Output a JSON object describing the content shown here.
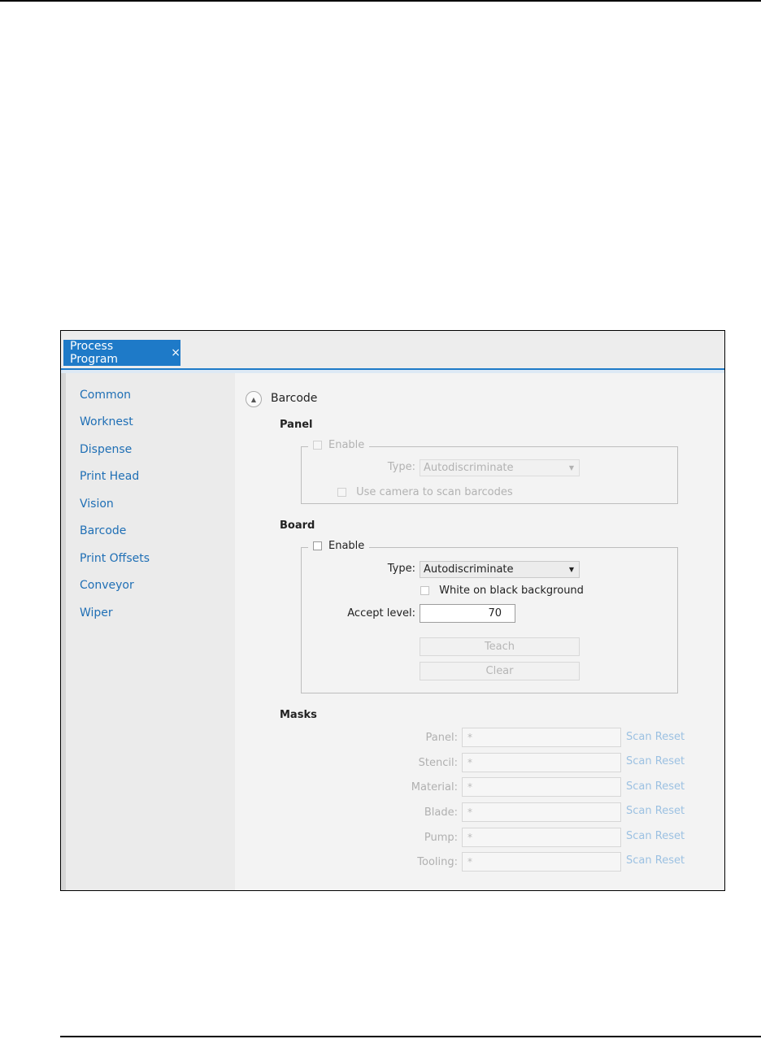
{
  "tab": {
    "title": "Process Program",
    "close": "×"
  },
  "sidebar": {
    "items": [
      {
        "label": "Common"
      },
      {
        "label": "Worknest"
      },
      {
        "label": "Dispense"
      },
      {
        "label": "Print Head"
      },
      {
        "label": "Vision"
      },
      {
        "label": "Barcode"
      },
      {
        "label": "Print Offsets"
      },
      {
        "label": "Conveyor"
      },
      {
        "label": "Wiper"
      }
    ]
  },
  "main": {
    "collapse_icon": "▲",
    "section_title": "Barcode",
    "panel": {
      "title": "Panel",
      "enable_label": "Enable",
      "type_label": "Type:",
      "type_value": "Autodiscriminate",
      "camera_label": "Use camera to scan barcodes"
    },
    "board": {
      "title": "Board",
      "enable_label": "Enable",
      "type_label": "Type:",
      "type_value": "Autodiscriminate",
      "white_label": "White on black background",
      "accept_label": "Accept level:",
      "accept_value": "70",
      "teach_label": "Teach",
      "clear_label": "Clear"
    },
    "masks": {
      "title": "Masks",
      "rows": [
        {
          "label": "Panel:",
          "value": "*",
          "scan": "Scan",
          "reset": "Reset"
        },
        {
          "label": "Stencil:",
          "value": "*",
          "scan": "Scan",
          "reset": "Reset"
        },
        {
          "label": "Material:",
          "value": "*",
          "scan": "Scan",
          "reset": "Reset"
        },
        {
          "label": "Blade:",
          "value": "*",
          "scan": "Scan",
          "reset": "Reset"
        },
        {
          "label": "Pump:",
          "value": "*",
          "scan": "Scan",
          "reset": "Reset"
        },
        {
          "label": "Tooling:",
          "value": "*",
          "scan": "Scan",
          "reset": "Reset"
        }
      ]
    },
    "dropdown_arrow": "▼"
  },
  "colors": {
    "accent": "#1e7ac8",
    "link": "#1f6fb5",
    "disabled_text": "#b2b2b2"
  }
}
